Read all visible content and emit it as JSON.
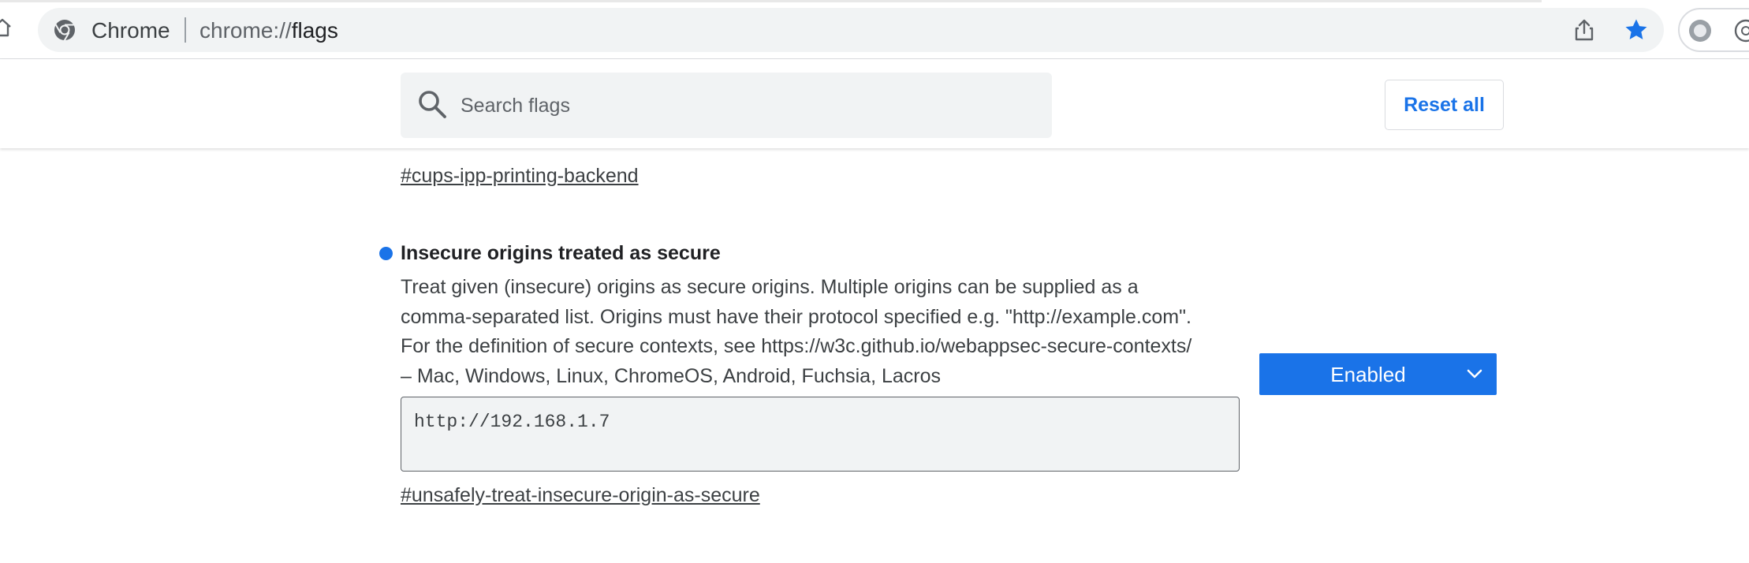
{
  "browser": {
    "site_name": "Chrome",
    "url_scheme": "chrome://",
    "url_host": "flags",
    "icons": [
      "home-icon",
      "chrome-logo-icon",
      "share-icon",
      "bookmark-star-icon",
      "profile-icon",
      "extension-icon"
    ],
    "accent_color": "#1a73e8"
  },
  "header": {
    "search_placeholder": "Search flags",
    "search_value": "",
    "reset_label": "Reset all"
  },
  "previous_flag": {
    "link": "#cups-ipp-printing-backend"
  },
  "flag": {
    "title": "Insecure origins treated as secure",
    "description_lines": [
      "Treat given (insecure) origins as secure origins. Multiple origins can be supplied as a",
      "comma-separated list. Origins must have their protocol specified e.g. \"http://example.com\".",
      "For the definition of secure contexts, see https://w3c.github.io/webappsec-secure-contexts/",
      "– Mac, Windows, Linux, ChromeOS, Android, Fuchsia, Lacros"
    ],
    "origins_value": "http://192.168.1.7",
    "state": "Enabled",
    "link": "#unsafely-treat-insecure-origin-as-secure",
    "modified_indicator_color": "#1a73e8"
  }
}
